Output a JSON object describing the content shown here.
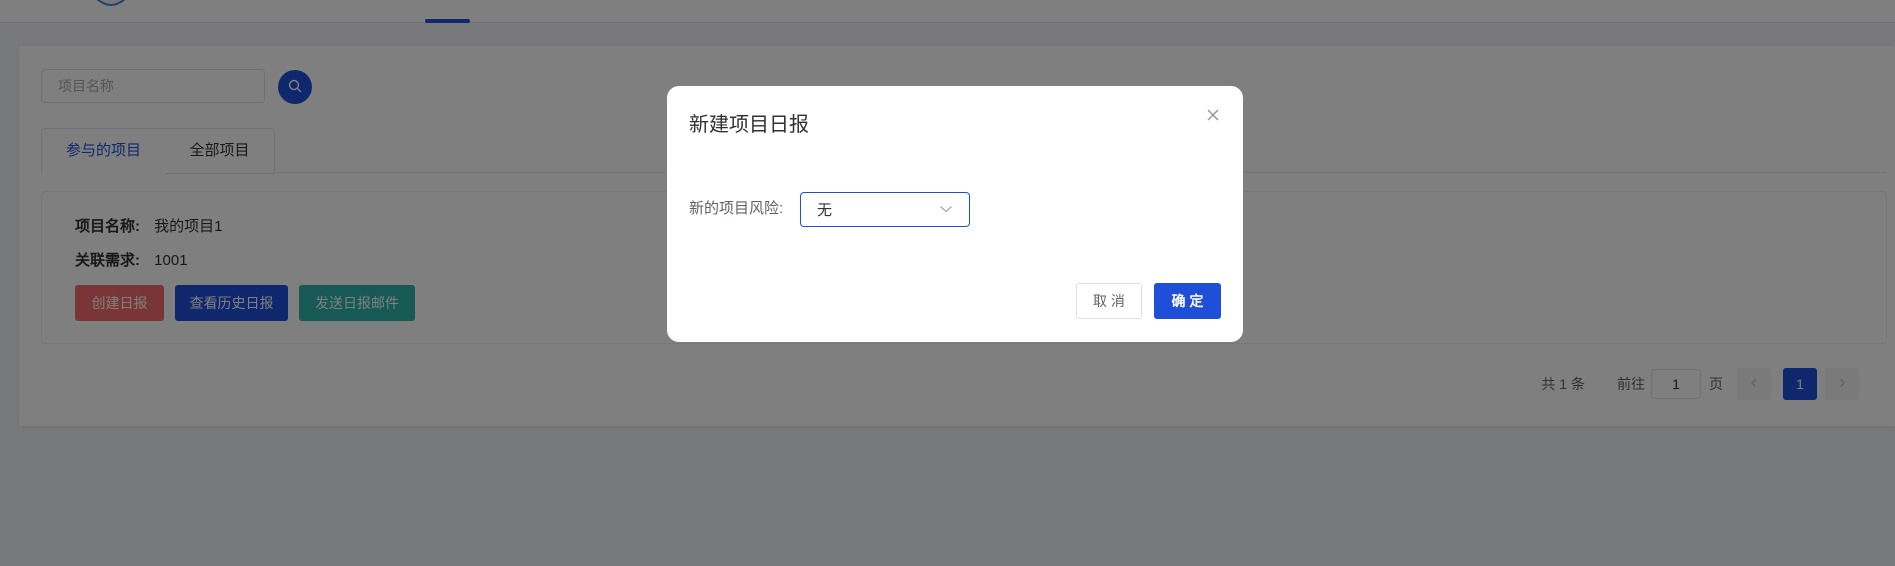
{
  "search": {
    "placeholder": "项目名称"
  },
  "tabs": [
    {
      "label": "参与的项目",
      "active": true
    },
    {
      "label": "全部项目",
      "active": false
    }
  ],
  "project": {
    "name_label": "项目名称:",
    "name_value": "我的项目1",
    "req_label": "关联需求:",
    "req_value": "1001",
    "buttons": {
      "create": "创建日报",
      "history": "查看历史日报",
      "send": "发送日报邮件"
    }
  },
  "pagination": {
    "total": "共 1 条",
    "goto": "前往",
    "page_input": "1",
    "page_word": "页",
    "current_page": "1"
  },
  "dialog": {
    "title": "新建项目日报",
    "field_label": "新的项目风险:",
    "select_value": "无",
    "cancel": "取 消",
    "confirm": "确 定"
  },
  "colors": {
    "primary": "#1f4fd8",
    "danger": "#f56c6c",
    "teal": "#2fb3a8"
  },
  "icons": [
    "search-icon",
    "close-icon",
    "chevron-down-icon",
    "chevron-left-icon",
    "chevron-right-icon",
    "logo-icon"
  ]
}
